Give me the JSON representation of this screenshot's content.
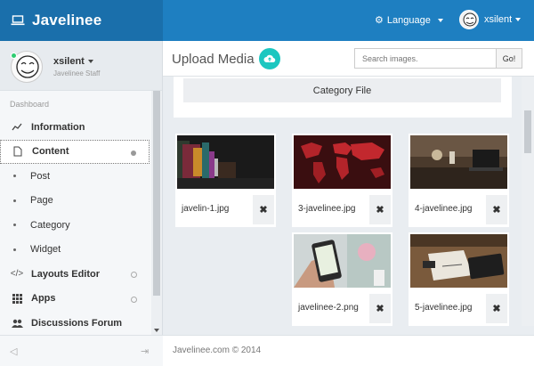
{
  "brand": {
    "title": "Javelinee"
  },
  "topbar": {
    "language_label": "Language",
    "username": "xsilent"
  },
  "profile": {
    "name": "xsilent",
    "role": "Javelinee Staff"
  },
  "sidebar": {
    "section_label": "Dashboard",
    "items": [
      {
        "label": "Information",
        "icon": "chart-line-icon"
      },
      {
        "label": "Content",
        "icon": "file-icon"
      },
      {
        "label": "Post"
      },
      {
        "label": "Page"
      },
      {
        "label": "Category"
      },
      {
        "label": "Widget"
      },
      {
        "label": "Layouts Editor",
        "icon": "code-icon"
      },
      {
        "label": "Apps",
        "icon": "grid-icon"
      },
      {
        "label": "Discussions Forum",
        "icon": "users-icon"
      }
    ]
  },
  "main": {
    "title": "Upload Media",
    "search_placeholder": "Search images.",
    "search_button": "Go!",
    "category_button": "Category File",
    "images": [
      {
        "name": "javelin-1.jpg"
      },
      {
        "name": "3-javelinee.jpg"
      },
      {
        "name": "4-javelinee.jpg"
      },
      {
        "name": "javelinee-2.png"
      },
      {
        "name": "5-javelinee.jpg"
      }
    ],
    "footer": "Javelinee.com © 2014"
  },
  "colors": {
    "topbar": "#1e7fc1",
    "brand_bg": "#1a6fab",
    "accent": "#1cc7c0"
  }
}
